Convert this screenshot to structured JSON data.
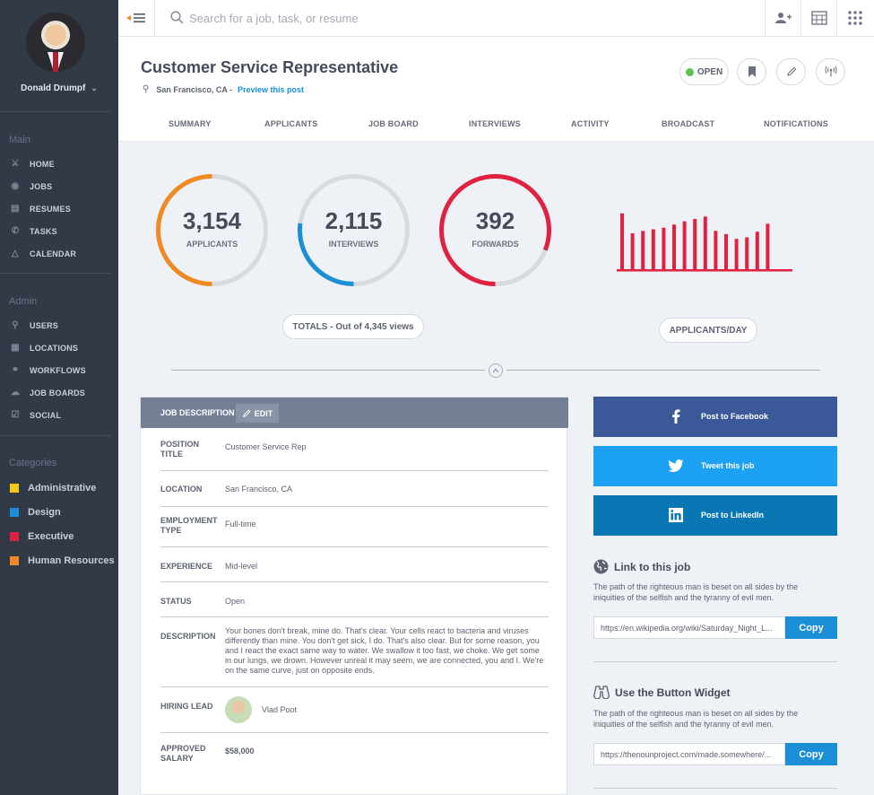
{
  "user": {
    "name": "Donald Drumpf"
  },
  "sidebar": {
    "main_label": "Main",
    "main_items": [
      {
        "label": "HOME",
        "icon": "home-icon"
      },
      {
        "label": "JOBS",
        "icon": "jobs-icon"
      },
      {
        "label": "RESUMES",
        "icon": "resumes-icon"
      },
      {
        "label": "TASKS",
        "icon": "tasks-icon"
      },
      {
        "label": "CALENDAR",
        "icon": "calendar-icon"
      }
    ],
    "admin_label": "Admin",
    "admin_items": [
      {
        "label": "USERS",
        "icon": "users-icon"
      },
      {
        "label": "LOCATIONS",
        "icon": "locations-icon"
      },
      {
        "label": "WORKFLOWS",
        "icon": "workflows-icon"
      },
      {
        "label": "JOB BOARDS",
        "icon": "job-boards-icon"
      },
      {
        "label": "SOCIAL",
        "icon": "social-icon"
      }
    ],
    "categories_label": "Categories",
    "categories": [
      {
        "label": "Administrative",
        "color": "#f5c518"
      },
      {
        "label": "Design",
        "color": "#1b8fd6"
      },
      {
        "label": "Executive",
        "color": "#e0213f"
      },
      {
        "label": "Human Resources",
        "color": "#f08a24"
      }
    ]
  },
  "search": {
    "placeholder": "Search for a job, task, or resume"
  },
  "job": {
    "title": "Customer Service Representative",
    "location": "San Francisco, CA -",
    "preview_link": "Preview this post",
    "status": "OPEN",
    "status_color": "#5bc24a"
  },
  "tabs": [
    "SUMMARY",
    "APPLICANTS",
    "JOB BOARD",
    "INTERVIEWS",
    "ACTIVITY",
    "BROADCAST",
    "NOTIFICATIONS"
  ],
  "stats": [
    {
      "value": "3,154",
      "label": "APPLICANTS",
      "fraction": 0.5,
      "color": "#f08a24"
    },
    {
      "value": "2,115",
      "label": "INTERVIEWS",
      "fraction": 0.27,
      "color": "#1b8fd6"
    },
    {
      "value": "392",
      "label": "FORWARDS",
      "fraction": 0.81,
      "color": "#e0213f"
    }
  ],
  "totals_label": "TOTALS - Out of 4,345 views",
  "applicants_per_day_label": "APPLICANTS/DAY",
  "chart_data": {
    "type": "bar",
    "color": "#e0213f",
    "values": [
      70,
      45,
      48,
      50,
      52,
      56,
      60,
      63,
      66,
      48,
      44,
      38,
      40,
      47,
      57
    ]
  },
  "description_card": {
    "title": "JOB DESCRIPTION",
    "edit_label": "EDIT",
    "rows": [
      {
        "label": "POSITION TITLE",
        "value": "Customer Service Rep"
      },
      {
        "label": "LOCATION",
        "value": "San Francisco, CA"
      },
      {
        "label": "EMPLOYMENT TYPE",
        "value": "Full-time"
      },
      {
        "label": "EXPERIENCE",
        "value": "Mid-level"
      },
      {
        "label": "STATUS",
        "value": "Open"
      },
      {
        "label": "DESCRIPTION",
        "value": "Your bones don't break, mine do. That's clear. Your cells react to bacteria and viruses differently than mine. You don't get sick, I do. That's also clear. But for some reason, you and I react the exact same way to water. We swallow it too fast, we choke. We get some in our lungs, we drown. However unreal it may seem, we are connected, you and I. We're on the same curve, just on opposite ends."
      },
      {
        "label": "HIRING LEAD",
        "value": "Vlad Poot"
      },
      {
        "label": "APPROVED SALARY",
        "value": "$58,000"
      }
    ]
  },
  "share": [
    {
      "label": "Post to Facebook",
      "color": "#3b5998",
      "icon": "facebook-icon"
    },
    {
      "label": "Tweet this job",
      "color": "#1da1f2",
      "icon": "twitter-icon"
    },
    {
      "label": "Post to LinkedIn",
      "color": "#0a77b5",
      "icon": "linkedin-icon"
    }
  ],
  "link_widget": {
    "title": "Link to this job",
    "desc": "The path of the righteous man is beset on all sides by the iniquities of the selfish and the tyranny of evil men.",
    "url": "https://en.wikipedia.org/wiki/Saturday_Night_L...",
    "copy": "Copy"
  },
  "button_widget": {
    "title": "Use the Button Widget",
    "desc": "The path of the righteous man is beset on all sides by the iniquities of the selfish and the tyranny of evil men.",
    "url": "https://thenounproject.com/made.somewhere/...",
    "copy": "Copy"
  }
}
